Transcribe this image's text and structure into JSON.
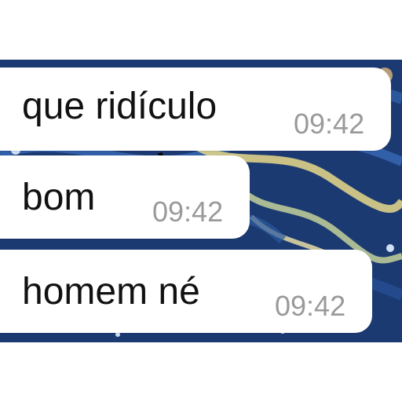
{
  "chat": {
    "messages": [
      {
        "text": "que ridículo",
        "time": "09:42"
      },
      {
        "text": "bom",
        "time": "09:42"
      },
      {
        "text": "homem né",
        "time": "09:42"
      }
    ]
  },
  "colors": {
    "bubble": "#ffffff",
    "message_text": "#111111",
    "timestamp": "#9a9a9a",
    "wallpaper_base": "#1c3a72",
    "wallpaper_swirl": "#e8d98a"
  }
}
